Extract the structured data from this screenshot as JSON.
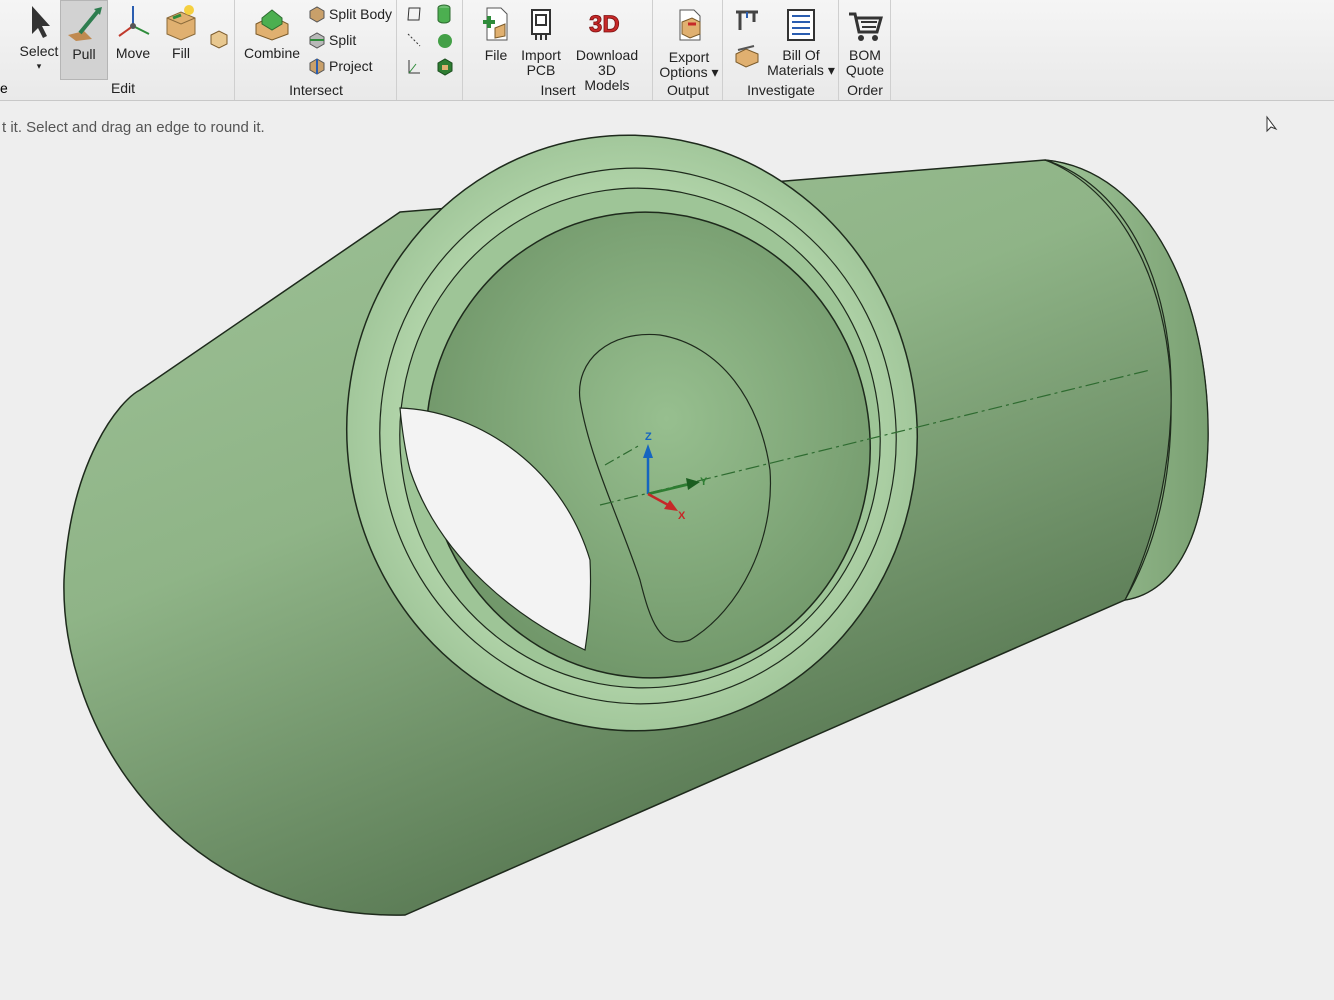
{
  "ribbon": {
    "edge_label": "e",
    "edit": {
      "label": "Edit",
      "select": "Select",
      "pull": "Pull",
      "move": "Move",
      "fill": "Fill"
    },
    "intersect": {
      "label": "Intersect",
      "combine": "Combine",
      "split_body": "Split Body",
      "split": "Split",
      "project": "Project"
    },
    "insert": {
      "label": "Insert",
      "file": "File",
      "import_pcb_1": "Import",
      "import_pcb_2": "PCB",
      "download_1": "Download 3D",
      "download_2": "Models"
    },
    "output": {
      "label": "Output",
      "export_1": "Export",
      "export_2": "Options ▾"
    },
    "investigate": {
      "label": "Investigate",
      "bom_1": "Bill Of",
      "bom_2": "Materials ▾"
    },
    "order": {
      "label": "Order",
      "quote_1": "BOM",
      "quote_2": "Quote"
    }
  },
  "status_hint": "t it. Select and drag an edge to round it.",
  "axes": {
    "z": "Z",
    "y": "Y",
    "x": "X"
  },
  "colors": {
    "model": "#9cbf94",
    "ribbon": "#f0f0f0",
    "canvas": "#eeeeee"
  }
}
